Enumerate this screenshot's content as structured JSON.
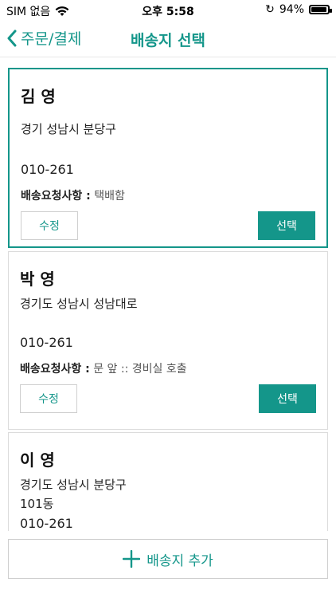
{
  "status_bar": {
    "carrier": "SIM 없음",
    "time": "오후 5:58",
    "battery_text": "94%",
    "battery_level": 0.94,
    "icons": [
      "wifi-icon",
      "orientation-lock-icon",
      "battery-icon"
    ]
  },
  "nav": {
    "back_label": "주문/결제",
    "title": "배송지 선택",
    "accent_color": "#14968a"
  },
  "addresses": [
    {
      "name": "김 영",
      "address": "경기 성남시 분당구",
      "address_line2": "",
      "phone": "010-261",
      "request_label": "배송요청사항 :",
      "request_value": "택배함",
      "edit_label": "수정",
      "select_label": "선택",
      "selected": true
    },
    {
      "name": "박 영",
      "address": "경기도 성남시 성남대로",
      "address_line2": "",
      "phone": "010-261",
      "request_label": "배송요청사항 :",
      "request_value": "문 앞 :: 경비실 호출",
      "edit_label": "수정",
      "select_label": "선택",
      "selected": false
    },
    {
      "name": "이 영",
      "address": "경기도 성남시 분당구",
      "address_line2": "101동",
      "phone": "010-261",
      "request_label": "",
      "request_value": "",
      "edit_label": "",
      "select_label": "",
      "selected": false
    }
  ],
  "add_button": {
    "label": "배송지 추가"
  }
}
